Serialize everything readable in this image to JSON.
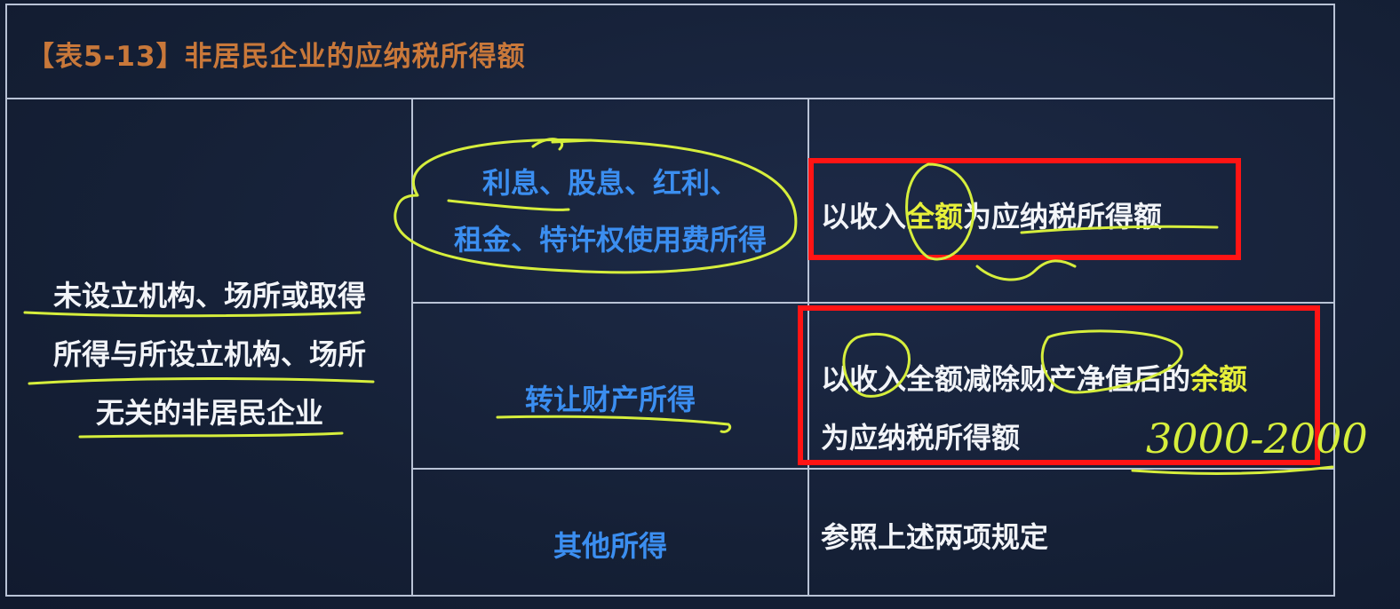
{
  "title": "【表5-13】非居民企业的应纳税所得额",
  "left_cell": {
    "lines": [
      "未设立机构、场所或取得",
      "所得与所设立机构、场所",
      "无关的非居民企业"
    ]
  },
  "rows": [
    {
      "income_lines": [
        "利息、股息、红利、",
        "租金、特许权使用费所得"
      ],
      "rule_parts": [
        "以收入",
        "全额",
        "为应纳税所得额"
      ]
    },
    {
      "income": "转让财产所得",
      "rule_line1_parts": [
        "以收入全额减除财产净值后的",
        "余额"
      ],
      "rule_line2": "为应纳税所得额"
    },
    {
      "income": "其他所得",
      "rule": "参照上述两项规定"
    }
  ],
  "handwriting": "3000-2000",
  "colors": {
    "background": "#15203a",
    "grid": "#b9c3d6",
    "title": "#c9783a",
    "income_text": "#3b8ef0",
    "rule_text": "#f2f4f8",
    "highlight": "#e7f03a",
    "red_box": "#ff1414",
    "ink": "#d6ee3c"
  }
}
